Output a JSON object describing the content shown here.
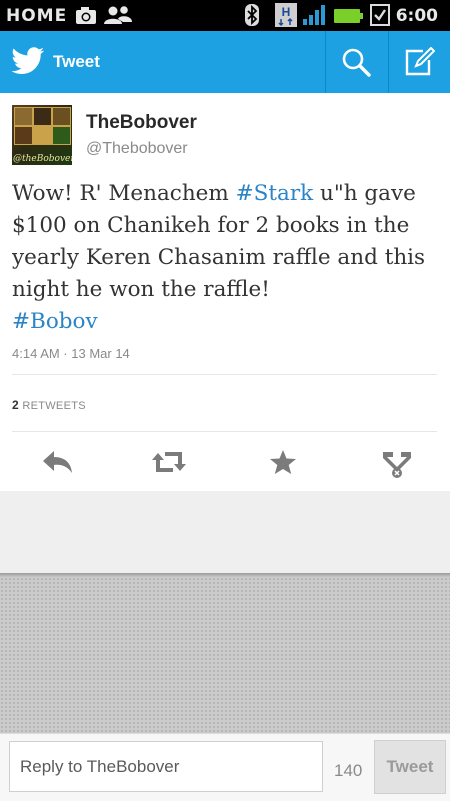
{
  "status_bar": {
    "carrier_label": "HOME",
    "time": "6:00",
    "icons": [
      "camera-icon",
      "people-icon",
      "bluetooth-icon",
      "hspa-icon",
      "signal-icon",
      "battery-icon",
      "checkbox-icon"
    ]
  },
  "action_bar": {
    "title": "Tweet",
    "icons": [
      "twitter-bird-icon",
      "search-icon",
      "compose-icon"
    ],
    "color": "#1da1e2"
  },
  "tweet": {
    "user_name": "TheBobover",
    "handle": "@Thebobover",
    "avatar_text": "@theBobover",
    "text_parts": {
      "part1": "Wow! R' Menachem ",
      "hashtag1": "#Stark",
      "part2": " u\"h gave $100 on Chanikeh for 2 books in the yearly Keren Chasanim raffle and this night he won the raffle!",
      "hashtag2": "#Bobov"
    },
    "timestamp": "4:14 AM · 13 Mar 14",
    "retweet_count": "2",
    "retweet_label": "RETWEETS",
    "hashtag_color": "#2a84c7"
  },
  "actions": [
    "reply-icon",
    "retweet-icon",
    "favorite-icon",
    "more-icon"
  ],
  "reply": {
    "placeholder": "Reply to TheBobover",
    "char_count": "140",
    "button_label": "Tweet"
  }
}
